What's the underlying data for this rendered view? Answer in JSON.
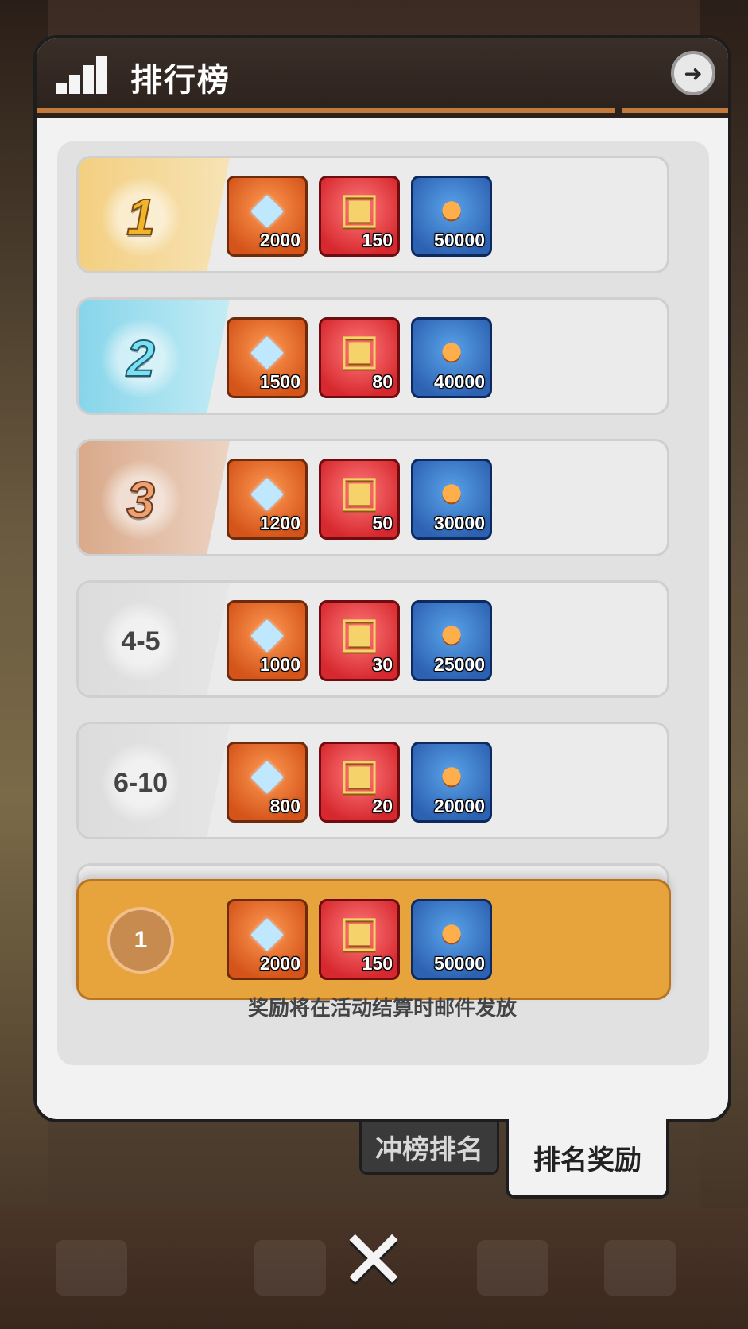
{
  "header": {
    "title": "排行榜"
  },
  "rows": [
    {
      "rank": "1",
      "items": [
        "2000",
        "150",
        "50000"
      ]
    },
    {
      "rank": "2",
      "items": [
        "1500",
        "80",
        "40000"
      ]
    },
    {
      "rank": "3",
      "items": [
        "1200",
        "50",
        "30000"
      ]
    },
    {
      "rank": "4-5",
      "items": [
        "1000",
        "30",
        "25000"
      ]
    },
    {
      "rank": "6-10",
      "items": [
        "800",
        "20",
        "20000"
      ]
    }
  ],
  "my_rank": {
    "rank": "1",
    "items": [
      "2000",
      "150",
      "50000"
    ]
  },
  "item_icons": [
    "gem-icon",
    "chest-icon",
    "fish-icon"
  ],
  "footer_note": "奖励将在活动结算时邮件发放",
  "tabs": {
    "ranking": "冲榜排名",
    "rewards": "排名奖励"
  },
  "colors": {
    "accent": "#e8a43c",
    "header": "#2b211c",
    "stripe": "#c27a3c"
  }
}
